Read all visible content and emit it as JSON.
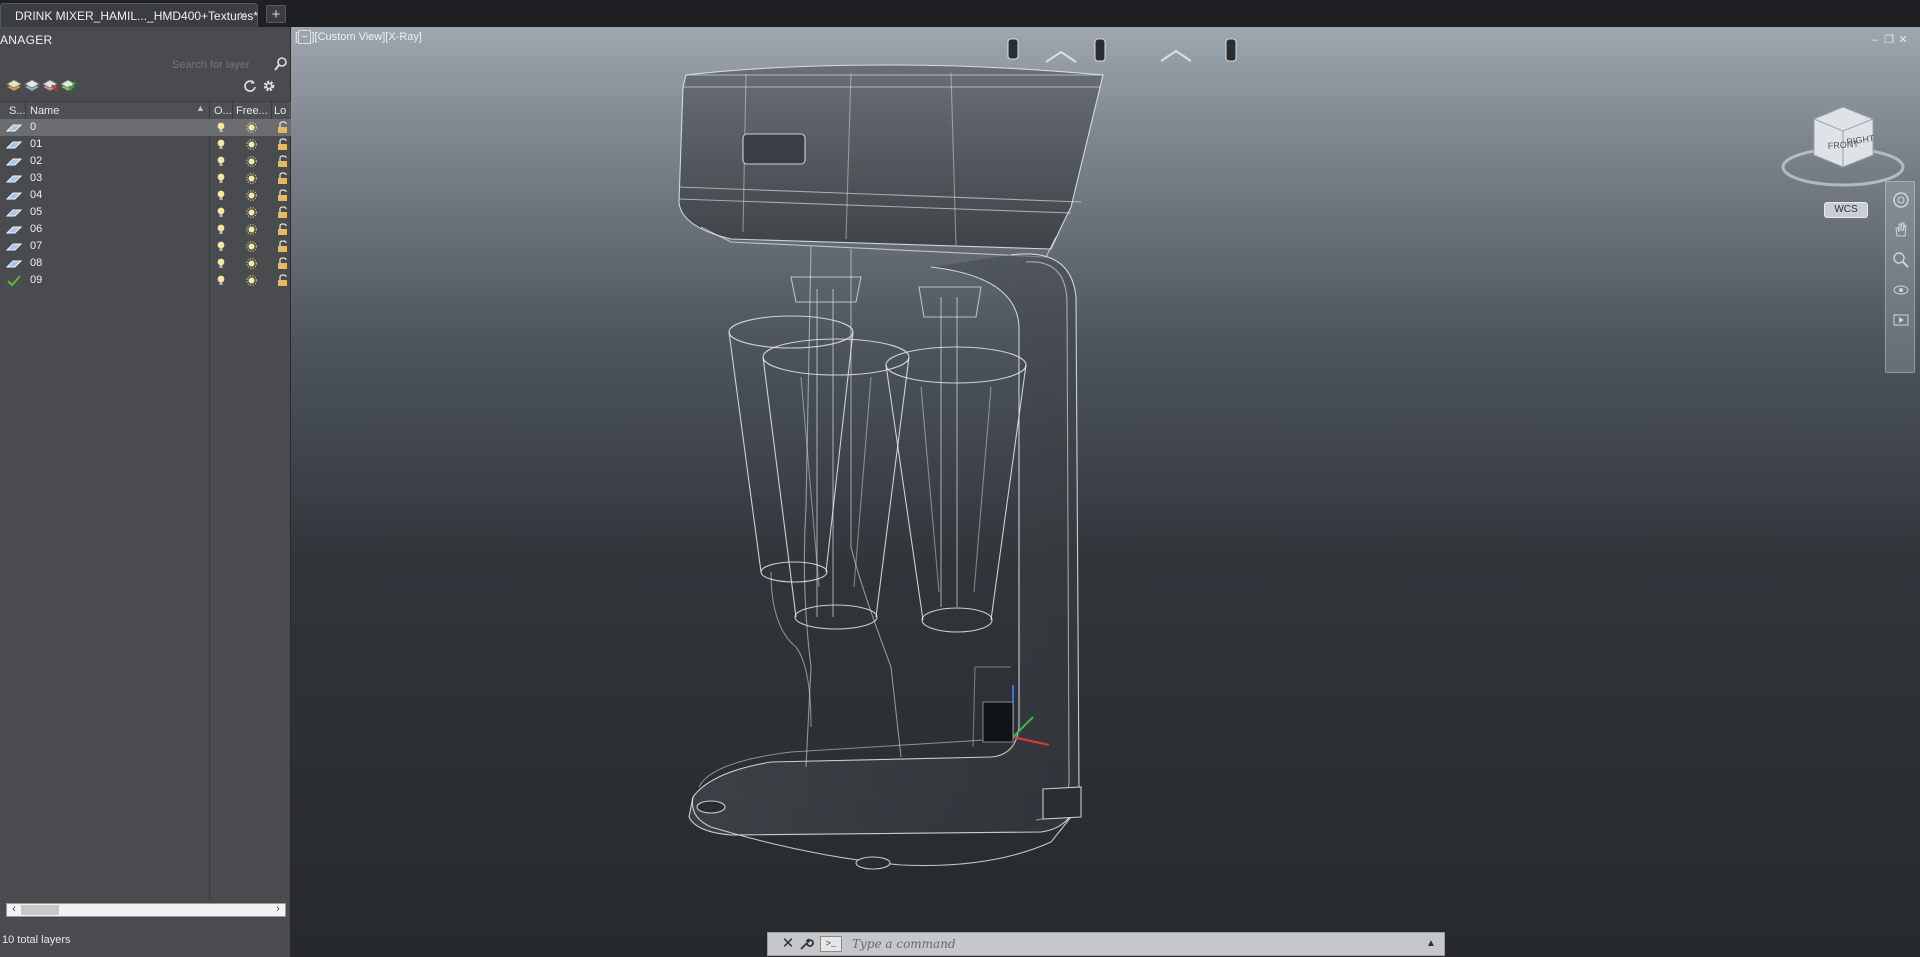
{
  "tabs": {
    "document_title": "DRINK MIXER_HAMIL..._HMD400+Textures*",
    "close_glyph": "×",
    "new_tab_glyph": "+"
  },
  "layer_manager": {
    "title": "ANAGER",
    "search_placeholder": "Search for layer",
    "columns": {
      "status": "S...",
      "name": "Name",
      "on": "O...",
      "freeze": "Free...",
      "lock": "Lo"
    },
    "layers": [
      {
        "name": "0",
        "current": false,
        "selected": true
      },
      {
        "name": "01",
        "current": false,
        "selected": false
      },
      {
        "name": "02",
        "current": false,
        "selected": false
      },
      {
        "name": "03",
        "current": false,
        "selected": false
      },
      {
        "name": "04",
        "current": false,
        "selected": false
      },
      {
        "name": "05",
        "current": false,
        "selected": false
      },
      {
        "name": "06",
        "current": false,
        "selected": false
      },
      {
        "name": "07",
        "current": false,
        "selected": false
      },
      {
        "name": "08",
        "current": false,
        "selected": false
      },
      {
        "name": "09",
        "current": true,
        "selected": false
      }
    ],
    "total_text": "10 total layers"
  },
  "viewport": {
    "label_prefix": "−",
    "label_text": "][Custom View][X-Ray]",
    "viewcube": {
      "front": "FRONT",
      "right": "RIGHT"
    },
    "wcs_label": "WCS"
  },
  "command_line": {
    "placeholder": "Type a command",
    "prompt_glyph": ">_"
  },
  "colors": {
    "accent_current_layer": "#5fb83a",
    "bulb_on": "#f5e6a0",
    "lock_open": "#e3b96a"
  }
}
